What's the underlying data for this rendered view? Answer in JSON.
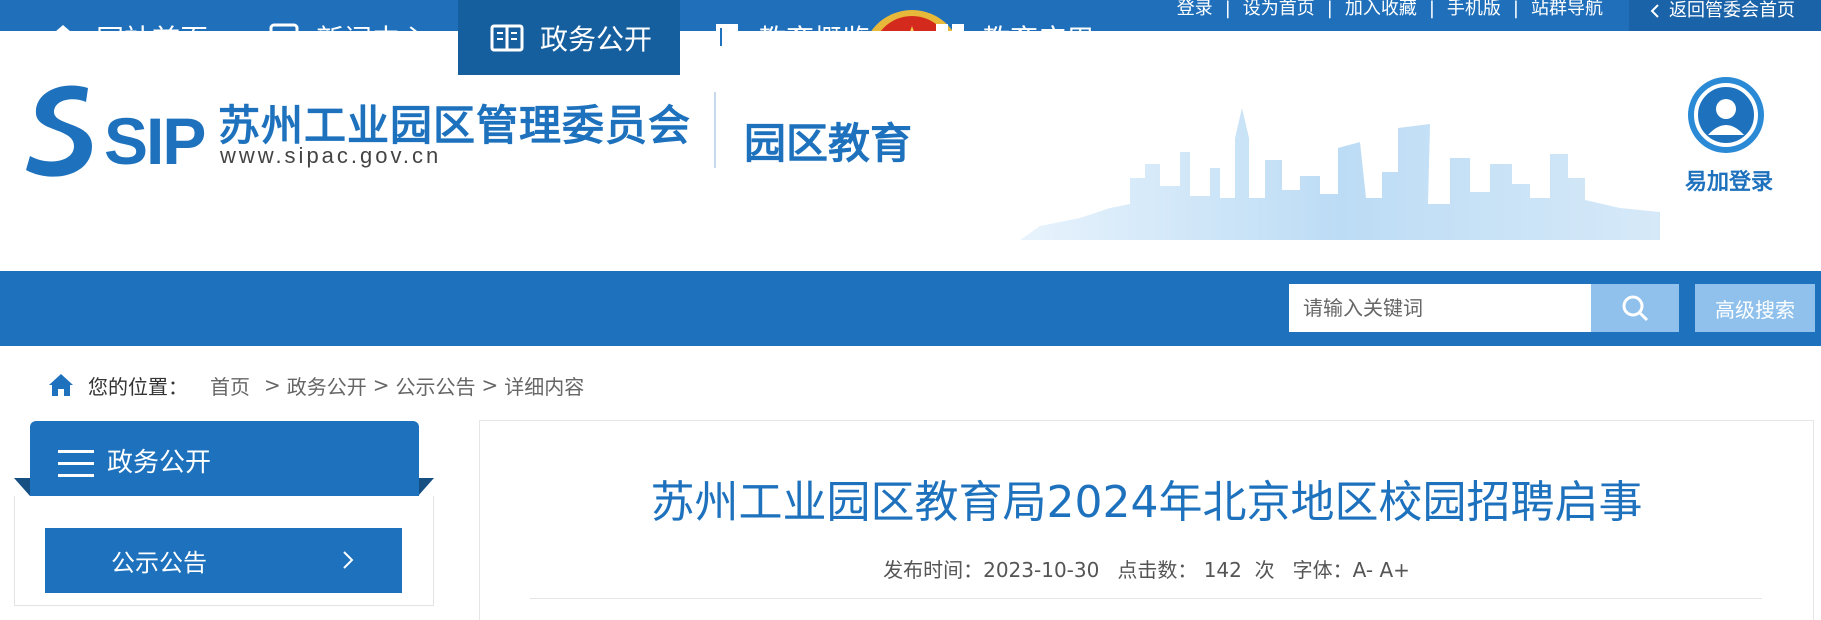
{
  "topbar": {
    "links": [
      "登录",
      "设为首页",
      "加入收藏",
      "手机版",
      "站群导航"
    ],
    "back_label": "返回管委会首页"
  },
  "header": {
    "logo_text": "SIP",
    "org_name": "苏州工业园区管理委员会",
    "org_url": "www.sipac.gov.cn",
    "section_name": "园区教育",
    "login_label": "易加登录"
  },
  "nav": {
    "items": [
      {
        "label": "网站首页",
        "icon": "home-icon"
      },
      {
        "label": "新闻中心",
        "icon": "news-icon"
      },
      {
        "label": "政务公开",
        "icon": "book-icon",
        "active": true
      },
      {
        "label": "教育概览",
        "icon": "notebook-icon"
      },
      {
        "label": "教育应用",
        "icon": "apps-icon"
      }
    ],
    "search_placeholder": "请输入关键词",
    "advanced_search_label": "高级搜索"
  },
  "breadcrumb": {
    "label": "您的位置：",
    "items": [
      "首页",
      "政务公开",
      "公示公告",
      "详细内容"
    ]
  },
  "sidebar": {
    "title": "政务公开",
    "items": [
      "公示公告"
    ]
  },
  "article": {
    "title": "苏州工业园区教育局2024年北京地区校园招聘启事",
    "publish_label": "发布时间：",
    "publish_date": "2023-10-30",
    "clicks_label": "点击数：",
    "clicks": "142",
    "clicks_unit": "次",
    "font_label": "字体：",
    "font_smaller": "A-",
    "font_larger": "A+"
  },
  "colors": {
    "primary": "#1e72bd",
    "nav_active": "#165f9f",
    "button_light": "#8fc1ec"
  }
}
